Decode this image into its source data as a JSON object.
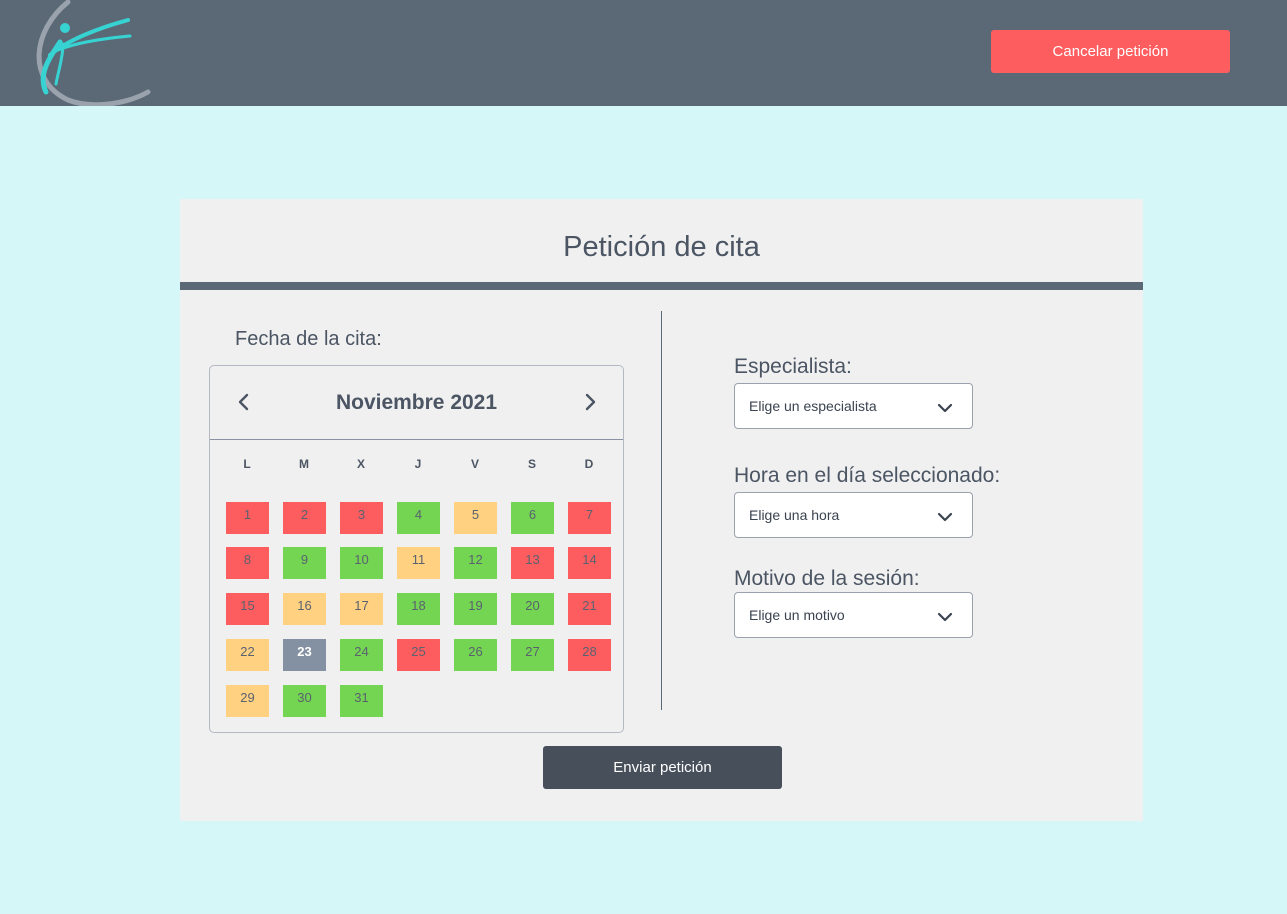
{
  "header": {
    "cancel_label": "Cancelar petición",
    "brand_color": "#5b6977",
    "cancel_color": "#fd5d5f"
  },
  "form": {
    "title": "Petición de cita",
    "date_label": "Fecha de la cita:",
    "calendar": {
      "month_label": "Noviembre 2021",
      "prev_icon": "chevron-left-icon",
      "next_icon": "chevron-right-icon",
      "weekdays": [
        "L",
        "M",
        "X",
        "J",
        "V",
        "S",
        "D"
      ],
      "days": [
        {
          "n": "1",
          "status": "red"
        },
        {
          "n": "2",
          "status": "red"
        },
        {
          "n": "3",
          "status": "red"
        },
        {
          "n": "4",
          "status": "green"
        },
        {
          "n": "5",
          "status": "orange"
        },
        {
          "n": "6",
          "status": "green"
        },
        {
          "n": "7",
          "status": "red"
        },
        {
          "n": "8",
          "status": "red"
        },
        {
          "n": "9",
          "status": "green"
        },
        {
          "n": "10",
          "status": "green"
        },
        {
          "n": "11",
          "status": "orange"
        },
        {
          "n": "12",
          "status": "green"
        },
        {
          "n": "13",
          "status": "red"
        },
        {
          "n": "14",
          "status": "red"
        },
        {
          "n": "15",
          "status": "red"
        },
        {
          "n": "16",
          "status": "orange"
        },
        {
          "n": "17",
          "status": "orange"
        },
        {
          "n": "18",
          "status": "green"
        },
        {
          "n": "19",
          "status": "green"
        },
        {
          "n": "20",
          "status": "green"
        },
        {
          "n": "21",
          "status": "red"
        },
        {
          "n": "22",
          "status": "orange"
        },
        {
          "n": "23",
          "status": "selected"
        },
        {
          "n": "24",
          "status": "green"
        },
        {
          "n": "25",
          "status": "red"
        },
        {
          "n": "26",
          "status": "green"
        },
        {
          "n": "27",
          "status": "green"
        },
        {
          "n": "28",
          "status": "red"
        },
        {
          "n": "29",
          "status": "orange"
        },
        {
          "n": "30",
          "status": "green"
        },
        {
          "n": "31",
          "status": "green"
        }
      ],
      "status_colors": {
        "red": "#fd5d5f",
        "green": "#74d552",
        "orange": "#ffd181",
        "selected": "#8491a2"
      }
    },
    "specialist": {
      "label": "Especialista:",
      "value": "Elige un especialista"
    },
    "hour": {
      "label": "Hora en el día seleccionado:",
      "value": "Elige una hora"
    },
    "reason": {
      "label": "Motivo de la  sesión:",
      "value": "Elige un motivo"
    },
    "send_label": "Enviar petición"
  }
}
